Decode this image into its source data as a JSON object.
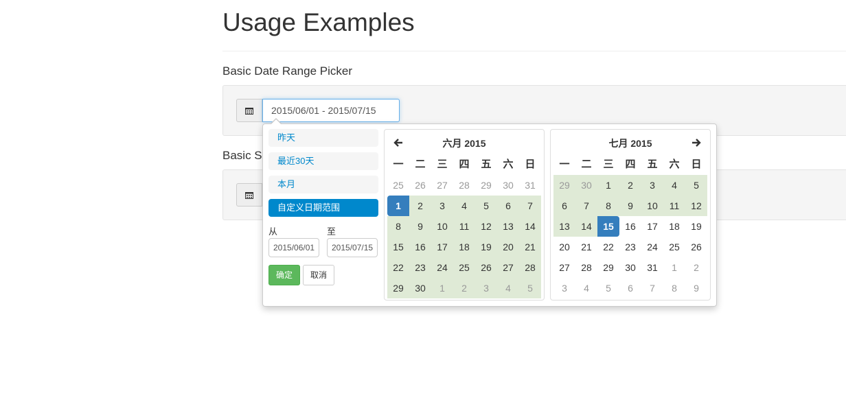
{
  "page": {
    "title": "Usage Examples",
    "section1_title": "Basic Date Range Picker",
    "section2_title": "Basic S"
  },
  "picker": {
    "input_value": "2015/06/01 - 2015/07/15",
    "ranges": [
      "昨天",
      "最近30天",
      "本月",
      "自定义日期范围"
    ],
    "active_range_index": 3,
    "from_label": "从",
    "to_label": "至",
    "from_value": "2015/06/01",
    "to_value": "2015/07/15",
    "apply_label": "确定",
    "cancel_label": "取消",
    "colors": {
      "accent": "#0088cc",
      "selected": "#357ebd",
      "in_range": "#dfead6",
      "apply": "#5cb85c"
    }
  },
  "calendars": [
    {
      "title": "六月 2015",
      "weekdays": [
        "一",
        "二",
        "三",
        "四",
        "五",
        "六",
        "日"
      ],
      "weeks": [
        [
          "25",
          "26",
          "27",
          "28",
          "29",
          "30",
          "31"
        ],
        [
          "1",
          "2",
          "3",
          "4",
          "5",
          "6",
          "7"
        ],
        [
          "8",
          "9",
          "10",
          "11",
          "12",
          "13",
          "14"
        ],
        [
          "15",
          "16",
          "17",
          "18",
          "19",
          "20",
          "21"
        ],
        [
          "22",
          "23",
          "24",
          "25",
          "26",
          "27",
          "28"
        ],
        [
          "29",
          "30",
          "1",
          "2",
          "3",
          "4",
          "5"
        ]
      ]
    },
    {
      "title": "七月 2015",
      "weekdays": [
        "一",
        "二",
        "三",
        "四",
        "五",
        "六",
        "日"
      ],
      "weeks": [
        [
          "29",
          "30",
          "1",
          "2",
          "3",
          "4",
          "5"
        ],
        [
          "6",
          "7",
          "8",
          "9",
          "10",
          "11",
          "12"
        ],
        [
          "13",
          "14",
          "15",
          "16",
          "17",
          "18",
          "19"
        ],
        [
          "20",
          "21",
          "22",
          "23",
          "24",
          "25",
          "26"
        ],
        [
          "27",
          "28",
          "29",
          "30",
          "31",
          "1",
          "2"
        ],
        [
          "3",
          "4",
          "5",
          "6",
          "7",
          "8",
          "9"
        ]
      ]
    }
  ]
}
